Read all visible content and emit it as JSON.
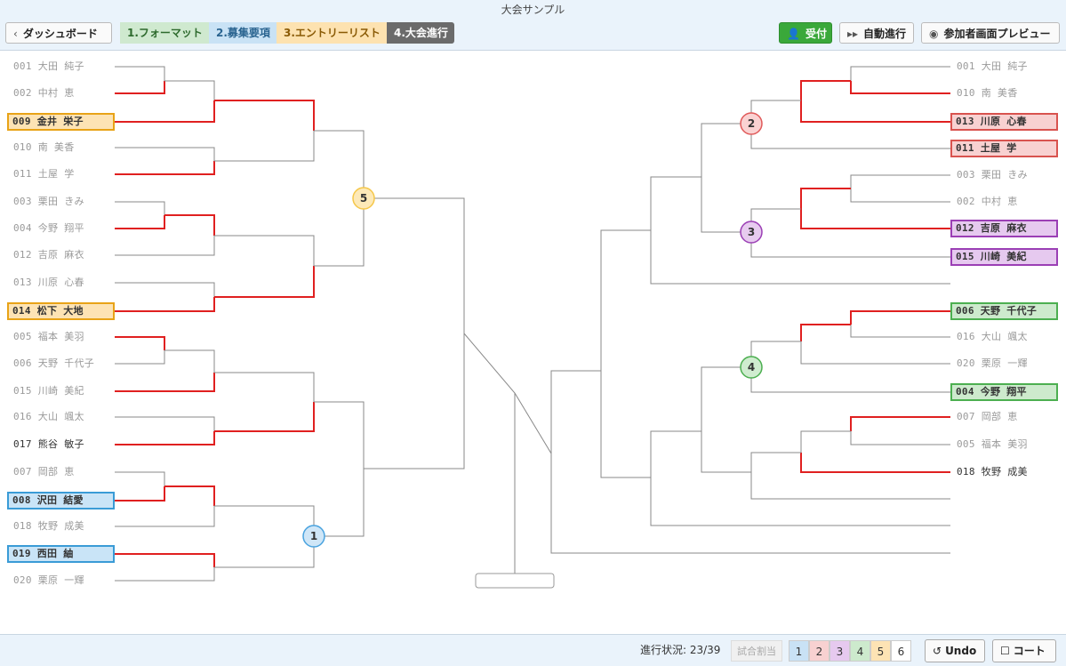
{
  "window_title": "大会サンプル",
  "toolbar": {
    "back_label": "ダッシュボード",
    "steps": [
      "1.フォーマット",
      "2.募集要項",
      "3.エントリーリスト",
      "4.大会進行"
    ],
    "reception_label": "受付",
    "auto_label": "自動進行",
    "preview_label": "参加者画面プレビュー"
  },
  "left_players": [
    {
      "label": "001 大田 純子"
    },
    {
      "label": "002 中村 恵"
    },
    {
      "label": "009 金井 栄子",
      "box": "orange"
    },
    {
      "label": "010 南 美香"
    },
    {
      "label": "011 土屋 学"
    },
    {
      "label": "003 栗田 きみ"
    },
    {
      "label": "004 今野 翔平"
    },
    {
      "label": "012 吉原 麻衣"
    },
    {
      "label": "013 川原 心春"
    },
    {
      "label": "014 松下 大地",
      "box": "orange"
    },
    {
      "label": "005 福本 美羽"
    },
    {
      "label": "006 天野 千代子"
    },
    {
      "label": "015 川崎 美紀"
    },
    {
      "label": "016 大山 颯太"
    },
    {
      "label": "017 熊谷 敏子",
      "dark": true
    },
    {
      "label": "007 岡部 恵"
    },
    {
      "label": "008 沢田 結愛",
      "box": "blue"
    },
    {
      "label": "018 牧野 成美"
    },
    {
      "label": "019 西田 紬",
      "box": "blue"
    },
    {
      "label": "020 栗原 一輝"
    }
  ],
  "right_players": [
    {
      "label": "001 大田 純子"
    },
    {
      "label": "010 南 美香"
    },
    {
      "label": "013 川原 心春",
      "box": "red"
    },
    {
      "label": "011 土屋 学",
      "box": "red"
    },
    {
      "label": "003 栗田 きみ"
    },
    {
      "label": "002 中村 恵"
    },
    {
      "label": "012 吉原 麻衣",
      "box": "purple"
    },
    {
      "label": "015 川崎 美紀",
      "box": "purple"
    },
    {
      "label": "006 天野 千代子",
      "box": "green"
    },
    {
      "label": "016 大山 颯太"
    },
    {
      "label": "020 栗原 一輝"
    },
    {
      "label": "004 今野 翔平",
      "box": "green"
    },
    {
      "label": "007 岡部 恵"
    },
    {
      "label": "005 福本 美羽"
    },
    {
      "label": "018 牧野 成美",
      "dark": true
    }
  ],
  "courts": [
    {
      "num": "5",
      "color": "#f5c74a",
      "fill": "#fde9b8"
    },
    {
      "num": "1",
      "color": "#4aa3df",
      "fill": "#cfe6f7"
    },
    {
      "num": "2",
      "color": "#e05a5a",
      "fill": "#fad2d2"
    },
    {
      "num": "3",
      "color": "#9b3fb5",
      "fill": "#e7cbef"
    },
    {
      "num": "4",
      "color": "#4caf50",
      "fill": "#cfeccf"
    }
  ],
  "box_colors": {
    "orange": {
      "border": "#e8a317",
      "bg": "#fde3b4"
    },
    "blue": {
      "border": "#3a9bd6",
      "bg": "#c9e4f7"
    },
    "red": {
      "border": "#d9534f",
      "bg": "#f8d1d1"
    },
    "purple": {
      "border": "#9b3fb5",
      "bg": "#e6c9ef"
    },
    "green": {
      "border": "#4caf50",
      "bg": "#cdeacd"
    }
  },
  "bottom": {
    "status": "進行状況: 23/39",
    "assign_label": "試合割当",
    "court_buttons": [
      "1",
      "2",
      "3",
      "4",
      "5",
      "6"
    ],
    "undo_label": "Undo",
    "court_label": "コート"
  },
  "colors": {
    "win_line": "#e02020",
    "line": "#888888",
    "accent_green": "#3aa83a"
  }
}
